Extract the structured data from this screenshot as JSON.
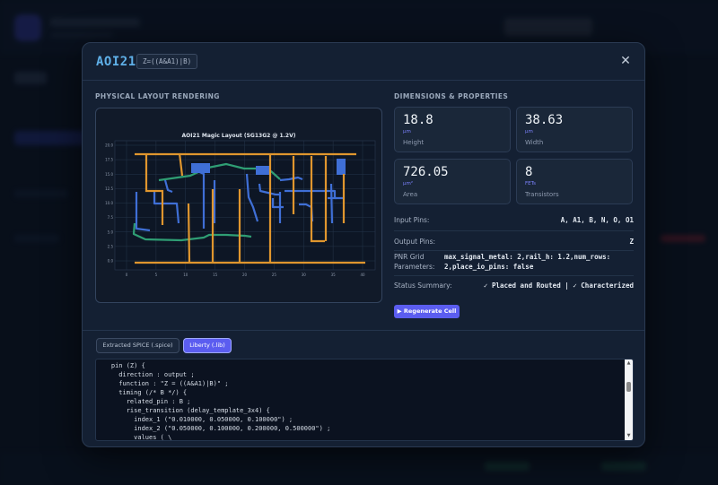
{
  "modal": {
    "cell_name": "AOI21",
    "function": "Z=((A&A1)|B)",
    "close_symbol": "✕"
  },
  "left_section_title": "PHYSICAL LAYOUT RENDERING",
  "right_section_title": "DIMENSIONS & PROPERTIES",
  "plot": {
    "title": "AOI21 Magic Layout (SG13G2 @ 1.2V)",
    "y_ticks": [
      "20.0",
      "17.5",
      "15.0",
      "12.5",
      "10.0",
      "7.5",
      "5.0",
      "2.5",
      "0.0"
    ],
    "x_ticks": [
      "0",
      "5",
      "10",
      "15",
      "20",
      "25",
      "30",
      "35",
      "40"
    ],
    "colors": {
      "orange": "#e0962e",
      "blue": "#3f6fd6",
      "green": "#2f9e74",
      "grid": "#24344a"
    }
  },
  "cards": [
    {
      "value": "18.8",
      "unit": "µm",
      "label": "Height"
    },
    {
      "value": "38.63",
      "unit": "µm",
      "label": "Width"
    },
    {
      "value": "726.05",
      "unit": "µm²",
      "label": "Area"
    },
    {
      "value": "8",
      "unit": "FETs",
      "label": "Transistors"
    }
  ],
  "properties": {
    "input_pins_label": "Input Pins:",
    "input_pins_value": "A, A1, B, N, O, O1",
    "output_pins_label": "Output Pins:",
    "output_pins_value": "Z",
    "pnr_label_1": "PNR Grid",
    "pnr_label_2": "Parameters:",
    "pnr_value_1": "max_signal_metal: 2,rail_h: 1.2,num_rows:",
    "pnr_value_2": "2,place_io_pins: false",
    "status_label": "Status Summary:",
    "status_value": "✓ Placed and Routed | ✓ Characterized"
  },
  "regenerate_button": "▶ Regenerate Cell",
  "tabs": {
    "spice": "Extracted SPICE (.spice)",
    "liberty": "Liberty (.lib)"
  },
  "code_lines": [
    "    pin (Z) {",
    "      direction : output ;",
    "      function : \"Z = ((A&A1)|B)\" ;",
    "      timing (/* B */) {",
    "        related_pin : B ;",
    "        rise_transition (delay_template_3x4) {",
    "          index_1 (\"0.010000, 0.050000, 0.100000\") ;",
    "          index_2 (\"0.050000, 0.100000, 0.200000, 0.500000\") ;",
    "          values ( \\"
  ]
}
